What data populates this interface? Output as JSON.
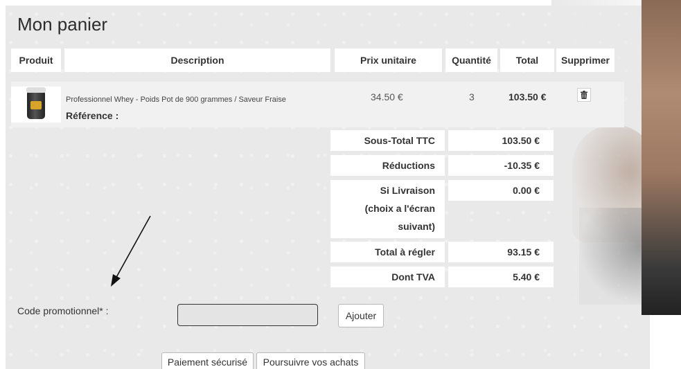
{
  "page": {
    "title": "Mon panier"
  },
  "table": {
    "headers": {
      "product": "Produit",
      "description": "Description",
      "unit_price": "Prix unitaire",
      "quantity": "Quantité",
      "total": "Total",
      "delete": "Supprimer"
    },
    "rows": [
      {
        "name": "Professionnel Whey - Poids Pot de 900 grammes / Saveur Fraise",
        "reference_label": "Référence :",
        "unit_price": "34.50 €",
        "quantity": "3",
        "total": "103.50 €"
      }
    ]
  },
  "summary": {
    "subtotal_label": "Sous-Total TTC",
    "subtotal_value": "103.50 €",
    "discount_label": "Réductions",
    "discount_value": "-10.35 €",
    "shipping_label_1": "Si Livraison",
    "shipping_label_2": "(choix a l'écran",
    "shipping_label_3": "suivant)",
    "shipping_value": "0.00 €",
    "total_label": "Total à régler",
    "total_value": "93.15 €",
    "vat_label": "Dont TVA",
    "vat_value": "5.40 €"
  },
  "promo": {
    "label": "Code promotionnel* :",
    "value": "",
    "add_button": "Ajouter"
  },
  "actions": {
    "secure_payment": "Paiement sécurisé",
    "continue_shopping": "Poursuivre vos achats"
  },
  "icons": {
    "delete": "trash-icon",
    "pointer": "arrow-icon"
  }
}
